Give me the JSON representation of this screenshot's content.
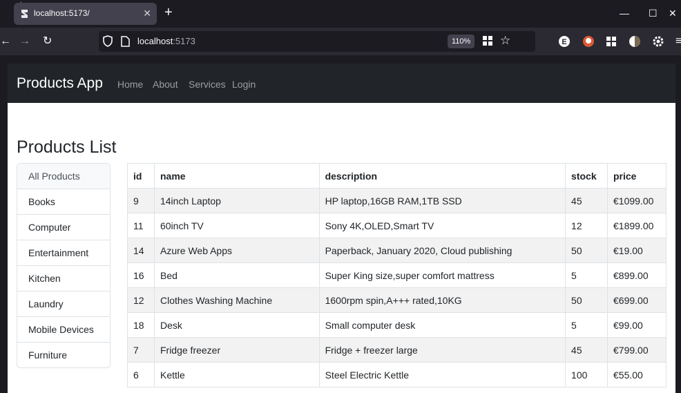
{
  "browser": {
    "tab_title": "localhost:5173/",
    "url_host": "localhost",
    "url_port": ":5173",
    "zoom": "110%"
  },
  "app": {
    "brand": "Products App",
    "nav": [
      "Home",
      "About",
      "Services",
      "Login"
    ],
    "page_title": "Products List"
  },
  "categories": [
    "All Products",
    "Books",
    "Computer",
    "Entertainment",
    "Kitchen",
    "Laundry",
    "Mobile Devices",
    "Furniture"
  ],
  "table": {
    "headers": [
      "id",
      "name",
      "description",
      "stock",
      "price"
    ],
    "rows": [
      [
        "9",
        "14inch Laptop",
        "HP laptop,16GB RAM,1TB SSD",
        "45",
        "€1099.00"
      ],
      [
        "11",
        "60inch TV",
        "Sony 4K,OLED,Smart TV",
        "12",
        "€1899.00"
      ],
      [
        "14",
        "Azure Web Apps",
        "Paperback, January 2020, Cloud publishing",
        "50",
        "€19.00"
      ],
      [
        "16",
        "Bed",
        "Super King size,super comfort mattress",
        "5",
        "€899.00"
      ],
      [
        "12",
        "Clothes Washing Machine",
        "1600rpm spin,A+++ rated,10KG",
        "50",
        "€699.00"
      ],
      [
        "18",
        "Desk",
        "Small computer desk",
        "5",
        "€99.00"
      ],
      [
        "7",
        "Fridge freezer",
        "Fridge + freezer large",
        "45",
        "€799.00"
      ],
      [
        "6",
        "Kettle",
        "Steel Electric Kettle",
        "100",
        "€55.00"
      ]
    ]
  },
  "colors": {
    "navbar": "#212529",
    "striped_row": "#f2f2f2",
    "border": "#dee2e6"
  }
}
